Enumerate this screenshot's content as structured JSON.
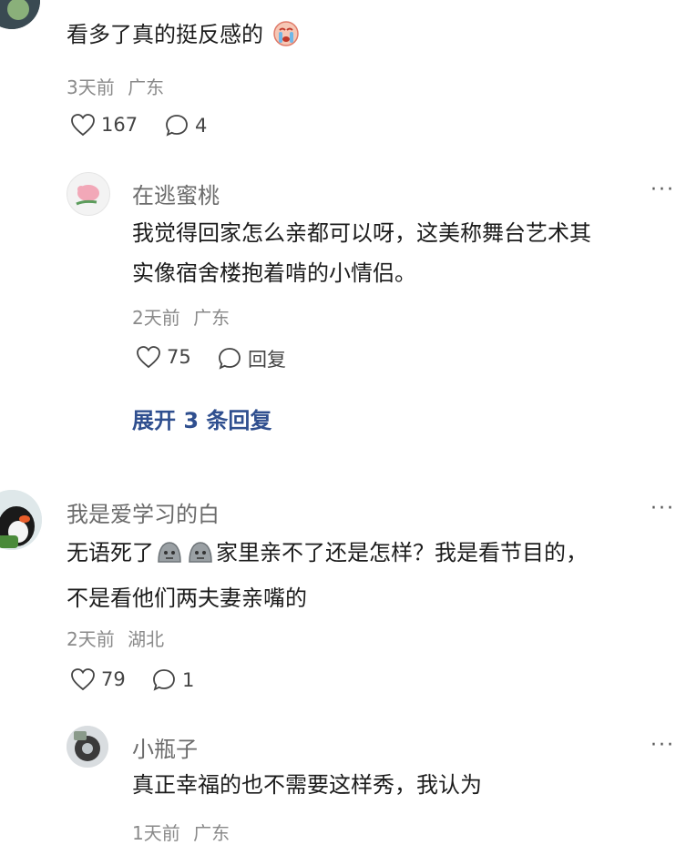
{
  "comments": [
    {
      "content": "看多了真的挺反感的",
      "time": "3天前",
      "location": "广东",
      "likes": "167",
      "replies": "4"
    },
    {
      "user": "在逃蜜桃",
      "content_line1": "我觉得回家怎么亲都可以呀，这美称舞台艺术其",
      "content_line2": "实像宿舍楼抱着啃的小情侣。",
      "time": "2天前",
      "location": "广东",
      "likes": "75",
      "reply_label": "回复",
      "expand_label": "展开 3 条回复"
    },
    {
      "user": "我是爱学习的白",
      "content_part1": "无语死了",
      "content_part2": "家里亲不了还是怎样？我是看节目的，",
      "content_line2": "不是看他们两夫妻亲嘴的",
      "time": "2天前",
      "location": "湖北",
      "likes": "79",
      "replies": "1"
    },
    {
      "user": "小瓶子",
      "content": "真正幸福的也不需要这样秀，我认为",
      "time_partial": "1天前",
      "location_partial": "广东"
    }
  ],
  "icons": {
    "like": "heart-outline-icon",
    "comment": "speech-bubble-icon",
    "more": "more-dots-icon"
  }
}
